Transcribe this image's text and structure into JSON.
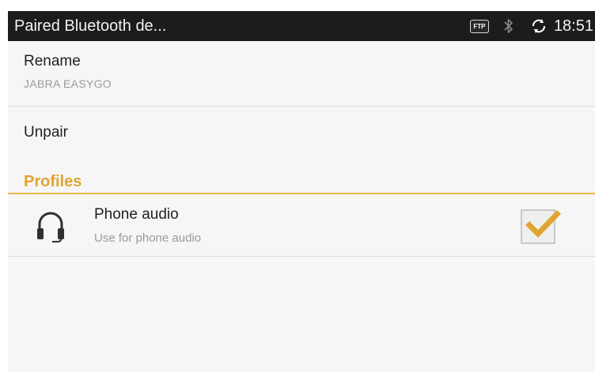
{
  "status_bar": {
    "title": "Paired Bluetooth de...",
    "ftp_badge": "FTP",
    "bluetooth_icon": "bluetooth-icon",
    "sync_icon": "sync-icon",
    "time": "18:51"
  },
  "settings": {
    "rename": {
      "label": "Rename",
      "value": "JABRA EASYGO"
    },
    "unpair": {
      "label": "Unpair"
    }
  },
  "profiles": {
    "header": "Profiles",
    "items": [
      {
        "icon": "headset-icon",
        "label": "Phone audio",
        "description": "Use for phone audio",
        "checked": true
      }
    ]
  },
  "colors": {
    "accent": "#e0a531",
    "status_bar_bg": "#1c1c1c",
    "screen_bg": "#f6f6f6"
  }
}
